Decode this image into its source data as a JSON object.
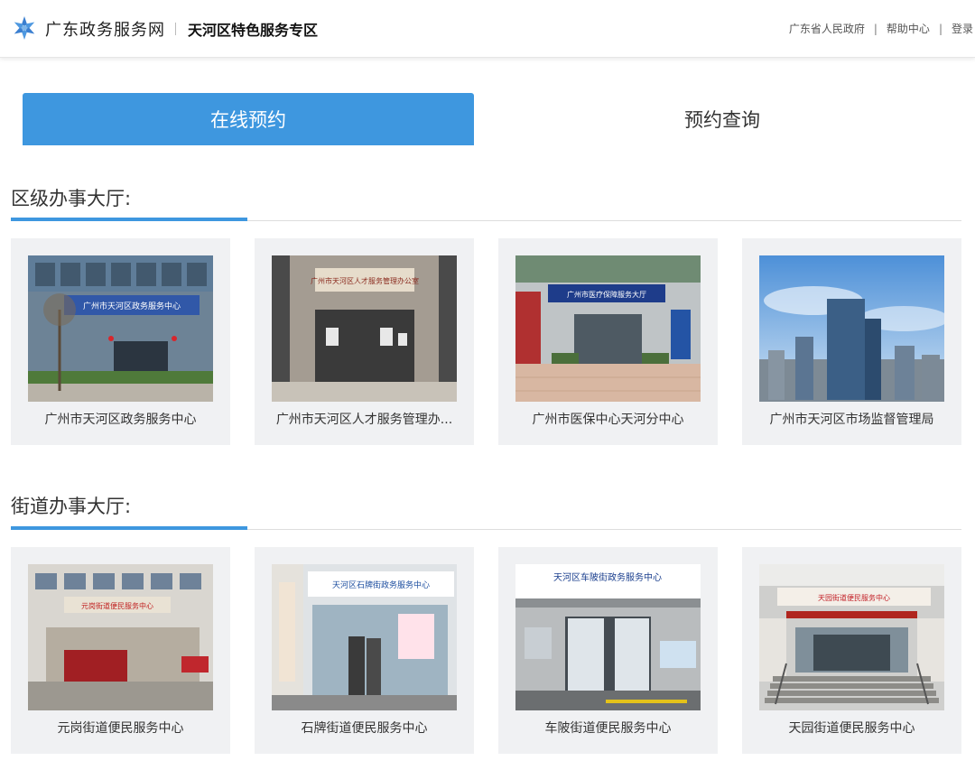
{
  "header": {
    "logo_icon": "star-flower-logo-icon",
    "site_name": "广东政务服务网",
    "zone_name": "天河区特色服务专区",
    "links": [
      "广东省人民政府",
      "帮助中心",
      "登录"
    ],
    "link_separator": "|"
  },
  "tabs": [
    {
      "label": "在线预约",
      "active": true
    },
    {
      "label": "预约查询",
      "active": false
    }
  ],
  "accent_color": "#3e97df",
  "sections": [
    {
      "title": "区级办事大厅:",
      "cards": [
        {
          "caption": "广州市天河区政务服务中心",
          "photo": "building-entrance-photo",
          "sign": "广州市天河区政务服务中心"
        },
        {
          "caption": "广州市天河区人才服务管理办...",
          "photo": "lobby-entrance-photo",
          "sign": "广州市天河区人才服务管理办公室"
        },
        {
          "caption": "广州市医保中心天河分中心",
          "photo": "hall-entrance-photo",
          "sign": "广州市医疗保障服务大厅"
        },
        {
          "caption": "广州市天河区市场监督管理局",
          "photo": "skyline-photo",
          "sign": ""
        }
      ]
    },
    {
      "title": "街道办事大厅:",
      "cards": [
        {
          "caption": "元岗街道便民服务中心",
          "photo": "building-entrance-photo",
          "sign": "元岗街道便民服务中心"
        },
        {
          "caption": "石牌街道便民服务中心",
          "photo": "glass-entrance-photo",
          "sign": "天河区石牌街政务服务中心"
        },
        {
          "caption": "车陂街道便民服务中心",
          "photo": "office-entrance-photo",
          "sign": "天河区车陂街政务服务中心"
        },
        {
          "caption": "天园街道便民服务中心",
          "photo": "stairs-entrance-photo",
          "sign": "天园街道便民服务中心"
        }
      ]
    }
  ]
}
